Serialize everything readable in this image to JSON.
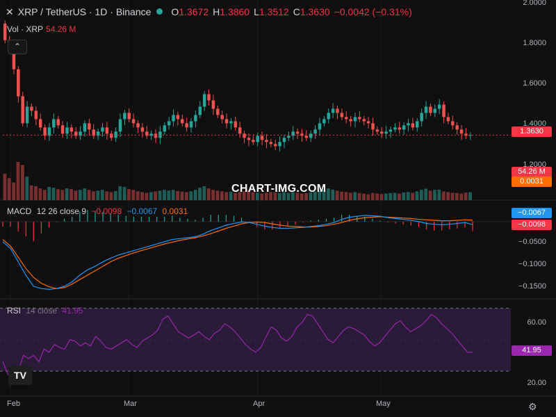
{
  "header": {
    "symbol": "XRP / TetherUS · 1D · Binance",
    "o_label": "O",
    "o_value": "1.3672",
    "h_label": "H",
    "h_value": "1.3860",
    "l_label": "L",
    "l_value": "1.3512",
    "c_label": "C",
    "c_value": "1.3630",
    "change": "−0.0042 (−0.31%)",
    "volume_label": "Vol · XRP",
    "volume_value": "54.26 M"
  },
  "macd_legend": {
    "label": "MACD",
    "params": "12 26 close 9",
    "hist": "−0.0098",
    "macd": "−0.0067",
    "signal": "0.0031"
  },
  "rsi_legend": {
    "label": "RSI",
    "params": "14 close",
    "value": "41.95"
  },
  "watermark": "CHART-IMG.COM",
  "tags": {
    "price": "1.3630",
    "volume": "54.26 M",
    "signal": "0.0031",
    "macd": "−0.0067",
    "hist": "−0.0098",
    "rsi": "41.95"
  },
  "axes": {
    "price_ticks": [
      "2.0000",
      "1.8000",
      "1.6000",
      "1.4000",
      "1.2000"
    ],
    "macd_ticks": [
      "−0.0500",
      "−0.1000",
      "−0.1500"
    ],
    "rsi_ticks": [
      "60.00",
      "20.00"
    ],
    "x_labels": [
      "Feb",
      "Mar",
      "Apr",
      "May"
    ]
  },
  "colors": {
    "up": "#26a69a",
    "down": "#ef5350",
    "macd_line": "#2196f3",
    "signal_line": "#ff6d00",
    "hist_neg": "#f23645",
    "rsi_line": "#9c27b0",
    "rsi_band": "#2a1b38"
  },
  "icons": {
    "logo": "tradingview-logo-icon",
    "settings": "gear-icon",
    "collapse": "chevron-up-icon"
  },
  "chart_data": [
    {
      "type": "candlestick",
      "title": "XRP / TetherUS · 1D · Binance",
      "x_labels": [
        "Feb",
        "Mar",
        "Apr",
        "May"
      ],
      "ylim": [
        1.05,
        2.0
      ],
      "series": [
        {
          "name": "XRP / TetherUS",
          "close": [
            1.82,
            1.78,
            1.68,
            1.55,
            1.42,
            1.5,
            1.48,
            1.44,
            1.4,
            1.36,
            1.4,
            1.44,
            1.41,
            1.37,
            1.4,
            1.38,
            1.36,
            1.38,
            1.42,
            1.39,
            1.36,
            1.38,
            1.4,
            1.37,
            1.35,
            1.38,
            1.44,
            1.47,
            1.44,
            1.42,
            1.4,
            1.38,
            1.36,
            1.37,
            1.35,
            1.38,
            1.41,
            1.43,
            1.46,
            1.44,
            1.42,
            1.4,
            1.43,
            1.46,
            1.5,
            1.56,
            1.53,
            1.49,
            1.46,
            1.44,
            1.42,
            1.43,
            1.4,
            1.37,
            1.35,
            1.34,
            1.33,
            1.36,
            1.34,
            1.33,
            1.32,
            1.31,
            1.33,
            1.35,
            1.36,
            1.38,
            1.37,
            1.36,
            1.35,
            1.37,
            1.39,
            1.42,
            1.44,
            1.47,
            1.49,
            1.47,
            1.45,
            1.44,
            1.43,
            1.45,
            1.44,
            1.43,
            1.42,
            1.39,
            1.38,
            1.37,
            1.38,
            1.39,
            1.4,
            1.39,
            1.41,
            1.42,
            1.4,
            1.43,
            1.47,
            1.5,
            1.47,
            1.49,
            1.51,
            1.45,
            1.43,
            1.41,
            1.39,
            1.37,
            1.36,
            1.363
          ]
        }
      ]
    },
    {
      "type": "bar",
      "title": "Vol · XRP",
      "series": [
        {
          "name": "Vol · XRP",
          "values": [
            180,
            150,
            120,
            260,
            240,
            160,
            100,
            95,
            80,
            70,
            90,
            85,
            75,
            70,
            80,
            75,
            65,
            70,
            80,
            70,
            60,
            65,
            70,
            60,
            55,
            62,
            95,
            90,
            75,
            70,
            60,
            55,
            50,
            55,
            60,
            65,
            70,
            65,
            70,
            62,
            58,
            55,
            60,
            70,
            85,
            95,
            80,
            70,
            65,
            60,
            55,
            58,
            50,
            55,
            60,
            65,
            55,
            50,
            45,
            50,
            55,
            52,
            48,
            55,
            50,
            55,
            50,
            45,
            48,
            52,
            58,
            65,
            70,
            80,
            72,
            65,
            58,
            55,
            50,
            55,
            48,
            45,
            40,
            48,
            45,
            42,
            45,
            48,
            50,
            45,
            52,
            55,
            50,
            60,
            70,
            78,
            65,
            70,
            72,
            60,
            55,
            50,
            48,
            45,
            52,
            54.26
          ]
        }
      ]
    },
    {
      "type": "line",
      "title": "MACD 12 26 close 9",
      "ylim": [
        -0.17,
        0.045
      ],
      "series": [
        {
          "name": "MACD",
          "values": [
            -0.045,
            -0.06,
            -0.09,
            -0.12,
            -0.145,
            -0.15,
            -0.152,
            -0.15,
            -0.145,
            -0.135,
            -0.12,
            -0.108,
            -0.1,
            -0.09,
            -0.082,
            -0.075,
            -0.07,
            -0.065,
            -0.06,
            -0.055,
            -0.05,
            -0.045,
            -0.04,
            -0.038,
            -0.036,
            -0.034,
            -0.028,
            -0.02,
            -0.014,
            -0.008,
            -0.004,
            -0.001,
            -0.002,
            -0.006,
            -0.01,
            -0.013,
            -0.015,
            -0.015,
            -0.014,
            -0.013,
            -0.011,
            -0.009,
            -0.006,
            -0.002,
            0.005,
            0.01,
            0.012,
            0.014,
            0.013,
            0.012,
            0.009,
            0.007,
            0.005,
            0.003,
            0.0,
            -0.004,
            -0.006,
            -0.007,
            -0.006,
            -0.004,
            -0.002,
            -0.0067
          ]
        },
        {
          "name": "Signal",
          "values": [
            -0.04,
            -0.055,
            -0.08,
            -0.105,
            -0.125,
            -0.138,
            -0.146,
            -0.15,
            -0.148,
            -0.14,
            -0.13,
            -0.12,
            -0.11,
            -0.1,
            -0.09,
            -0.082,
            -0.076,
            -0.07,
            -0.065,
            -0.06,
            -0.055,
            -0.05,
            -0.046,
            -0.042,
            -0.039,
            -0.036,
            -0.032,
            -0.027,
            -0.021,
            -0.015,
            -0.01,
            -0.005,
            -0.002,
            -0.001,
            -0.002,
            -0.005,
            -0.008,
            -0.01,
            -0.011,
            -0.012,
            -0.012,
            -0.011,
            -0.009,
            -0.006,
            -0.002,
            0.003,
            0.006,
            0.009,
            0.01,
            0.011,
            0.01,
            0.009,
            0.008,
            0.007,
            0.005,
            0.004,
            0.003,
            0.002,
            0.002,
            0.003,
            0.004,
            0.0031
          ]
        }
      ]
    },
    {
      "type": "line",
      "title": "RSI 14 close",
      "ylim": [
        15,
        75
      ],
      "series": [
        {
          "name": "RSI",
          "values": [
            36,
            28,
            22,
            30,
            40,
            38,
            40,
            36,
            44,
            42,
            47,
            45,
            44,
            50,
            49,
            46,
            48,
            46,
            52,
            49,
            45,
            44,
            46,
            48,
            50,
            47,
            45,
            49,
            51,
            53,
            56,
            63,
            65,
            60,
            55,
            53,
            51,
            53,
            55,
            52,
            50,
            54,
            56,
            60,
            58,
            55,
            51,
            47,
            44,
            42,
            45,
            52,
            58,
            56,
            51,
            49,
            52,
            58,
            61,
            66,
            65,
            60,
            55,
            50,
            48,
            52,
            56,
            58,
            57,
            55,
            53,
            49,
            46,
            48,
            52,
            56,
            60,
            62,
            58,
            55,
            57,
            59,
            62,
            66,
            64,
            60,
            57,
            54,
            50,
            46,
            42,
            41.95
          ]
        }
      ]
    }
  ]
}
